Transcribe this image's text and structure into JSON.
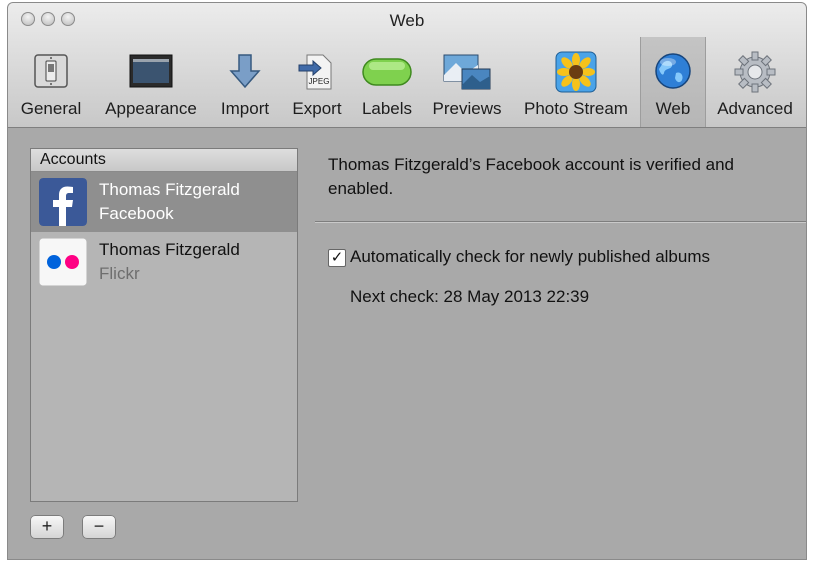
{
  "window": {
    "title": "Web"
  },
  "toolbar": {
    "items": [
      {
        "label": "General",
        "icon": "light-switch-icon"
      },
      {
        "label": "Appearance",
        "icon": "display-icon"
      },
      {
        "label": "Import",
        "icon": "download-arrow-icon"
      },
      {
        "label": "Export",
        "icon": "jpeg-file-icon",
        "badge": "JPEG"
      },
      {
        "label": "Labels",
        "icon": "label-pill-icon"
      },
      {
        "label": "Previews",
        "icon": "photos-icon"
      },
      {
        "label": "Photo Stream",
        "icon": "sunflower-icon"
      },
      {
        "label": "Web",
        "icon": "globe-icon",
        "selected": true
      },
      {
        "label": "Advanced",
        "icon": "gear-icon"
      }
    ]
  },
  "accounts": {
    "header": "Accounts",
    "items": [
      {
        "name": "Thomas Fitzgerald",
        "service": "Facebook",
        "icon": "facebook-icon",
        "selected": true
      },
      {
        "name": "Thomas Fitzgerald",
        "service": "Flickr",
        "icon": "flickr-icon",
        "selected": false
      }
    ],
    "add_label": "+",
    "remove_label": "−"
  },
  "detail": {
    "status_text": "Thomas Fitzgerald’s Facebook account is verified and enabled.",
    "auto_check_label": "Automatically check for newly published albums",
    "auto_check_checked": true,
    "check_mark": "✓",
    "next_check": "Next check: 28 May 2013 22:39"
  },
  "colors": {
    "window_bg": "#a9a9a9",
    "selected_row": "#8f8f8f",
    "facebook_blue": "#3b5998",
    "flickr_blue": "#0063dc",
    "flickr_pink": "#ff0084"
  }
}
